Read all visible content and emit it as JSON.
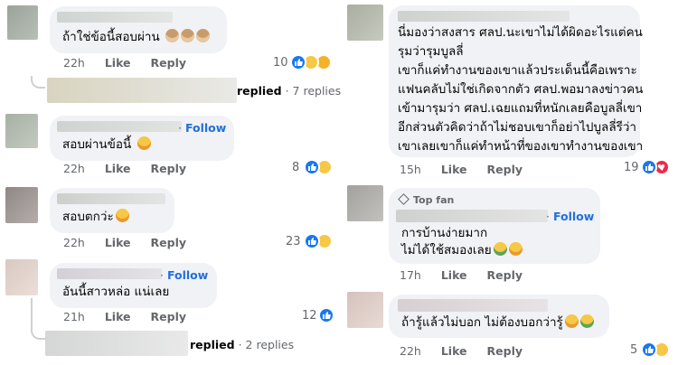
{
  "left": {
    "c1": {
      "text": "ถ้าใช่ข้อนี้สอบผ่าน",
      "time": "22h",
      "like": "Like",
      "reply": "Reply",
      "count": "10"
    },
    "r1": {
      "label": "replied",
      "count": "· 7 replies"
    },
    "c2": {
      "follow_dot": "·",
      "follow": "Follow",
      "text": "สอบผ่านข้อนี้",
      "time": "22h",
      "like": "Like",
      "reply": "Reply",
      "count": "8"
    },
    "c3": {
      "text": "สอบตกว่ะ",
      "time": "22h",
      "like": "Like",
      "reply": "Reply",
      "count": "23"
    },
    "c4": {
      "follow_dot": "·",
      "follow": "Follow",
      "text": "อันนี้สาวหล่อ แน่เลย",
      "time": "21h",
      "like": "Like",
      "reply": "Reply",
      "count": "12"
    },
    "r2": {
      "label": "replied",
      "count": "· 2 replies"
    }
  },
  "right": {
    "c1": {
      "lines": [
        "นี่มองว่าสงสาร ศลป.นะเขาไม่ได้ผิดอะไรแต่คน",
        "รุมว่ารุมบูลลี่",
        "เขาก็แค่ทำงานของเขาแล้วประเด็นนี้คือเพราะ",
        "แฟนคลับไม่ใช่เกิดจากตัว ศลป.พอมาลงข่าวคน",
        "เข้ามารุมว่า ศลป.เฉยแถมที่หนักเลยคือบูลลี่เขา",
        "อีกส่วนตัวคิดว่าถ้าไม่ชอบเขาก็อย่าไปบูลลี่รีว่า",
        "เขาเลยเขาก็แค่ทำหน้าที่ของเขาทำงานของเขา"
      ],
      "time": "15h",
      "like": "Like",
      "reply": "Reply",
      "count": "19"
    },
    "c2": {
      "badge": "Top fan",
      "follow_dot": "·",
      "follow": "Follow",
      "lines": [
        "การบ้านง่ายมาก",
        "ไม่ได้ใช้สมองเลย"
      ],
      "time": "17h",
      "like": "Like",
      "reply": "Reply"
    },
    "c3": {
      "text": "ถ้ารู้แล้วไม่บอก ไม่ต้องบอกว่ารู้",
      "time": "22h",
      "like": "Like",
      "reply": "Reply",
      "count": "5"
    }
  },
  "colors": {
    "bubble": "#f0f2f5",
    "link": "#216fdb",
    "meta": "#65676b",
    "like": "#1877f2",
    "haha": "#f7c845",
    "love": "#f0284a"
  },
  "icons": [
    "like-reaction-icon",
    "haha-reaction-icon",
    "love-reaction-icon",
    "care-reaction-icon",
    "top-fan-diamond-icon"
  ]
}
